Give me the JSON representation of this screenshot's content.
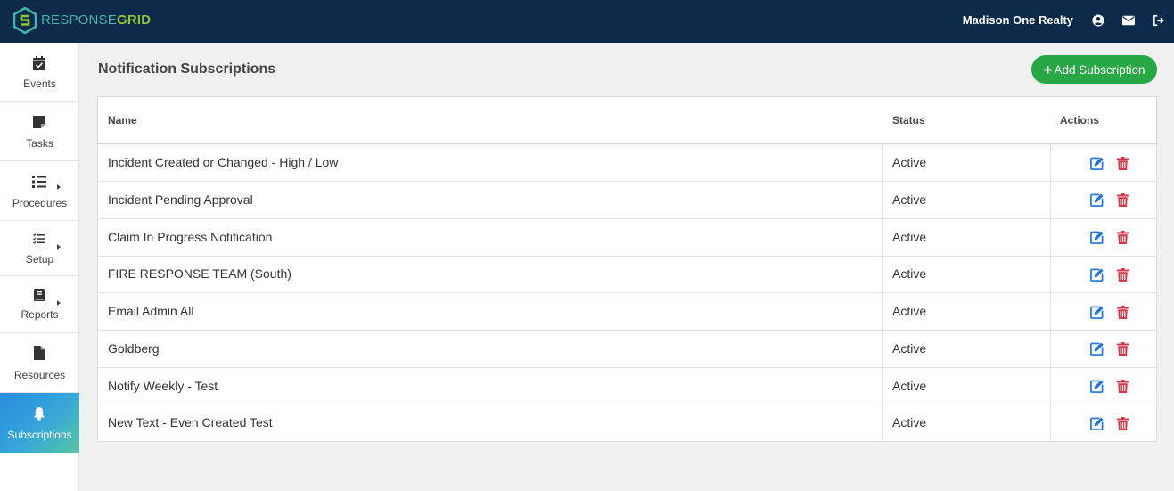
{
  "brand": {
    "part1": "RESPONSE",
    "part2": "GRID"
  },
  "header": {
    "company": "Madison One Realty",
    "icons": [
      "user-circle-icon",
      "envelope-icon",
      "sign-out-icon"
    ]
  },
  "sidebar": {
    "items": [
      {
        "label": "Events",
        "icon": "calendar-check-icon"
      },
      {
        "label": "Tasks",
        "icon": "sticky-note-icon"
      },
      {
        "label": "Procedures",
        "icon": "list-icon"
      },
      {
        "label": "Setup",
        "icon": "tasks-list-icon"
      },
      {
        "label": "Reports",
        "icon": "book-icon"
      },
      {
        "label": "Resources",
        "icon": "file-icon"
      },
      {
        "label": "Subscriptions",
        "icon": "bell-icon"
      }
    ],
    "active": "Subscriptions"
  },
  "page": {
    "title": "Notification Subscriptions",
    "add_button": "Add Subscription"
  },
  "table": {
    "headers": {
      "name": "Name",
      "status": "Status",
      "actions": "Actions"
    },
    "rows": [
      {
        "name": "Incident Created or Changed - High / Low",
        "status": "Active"
      },
      {
        "name": "Incident Pending Approval",
        "status": "Active"
      },
      {
        "name": "Claim In Progress Notification",
        "status": "Active"
      },
      {
        "name": "FIRE RESPONSE TEAM (South)",
        "status": "Active"
      },
      {
        "name": "Email Admin All",
        "status": "Active"
      },
      {
        "name": "Goldberg",
        "status": "Active"
      },
      {
        "name": "Notify Weekly - Test",
        "status": "Active"
      },
      {
        "name": "New Text - Even Created Test",
        "status": "Active"
      }
    ]
  },
  "colors": {
    "topbar": "#0d2a4a",
    "primary_button": "#28a745",
    "edit_icon": "#1a73e8",
    "delete_icon": "#dc3545"
  }
}
